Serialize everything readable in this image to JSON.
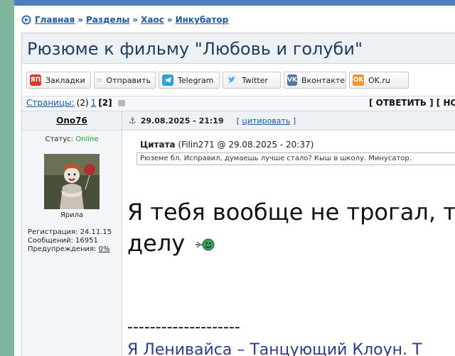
{
  "breadcrumbs": [
    {
      "label": "Главная"
    },
    {
      "label": "Разделы"
    },
    {
      "label": "Хаос"
    },
    {
      "label": "Инкубатор"
    }
  ],
  "breadcrumb_sep": "»",
  "topic": {
    "title": "Рюзюме к фильму \"Любовь и голуби\""
  },
  "share": [
    {
      "label": "Закладки",
      "icon": "yandex-icon",
      "icon_text": "ЯП",
      "color": "#d83b2a"
    },
    {
      "label": "Отправить",
      "icon": "mail-icon",
      "icon_text": "",
      "color": "#8a8a8a"
    },
    {
      "label": "Telegram",
      "icon": "telegram-icon",
      "icon_text": "",
      "color": "#2aa3de"
    },
    {
      "label": "Twitter",
      "icon": "twitter-icon",
      "icon_text": "",
      "color": "#4aa8e6"
    },
    {
      "label": "Вконтакте",
      "icon": "vk-icon",
      "icon_text": "VK",
      "color": "#4a76a8"
    },
    {
      "label": "OK.ru",
      "icon": "odnoklassniki-icon",
      "icon_text": "OK",
      "color": "#f2932c"
    }
  ],
  "pagination": {
    "label": "Страницы:",
    "total": "(2)",
    "pages": [
      "1",
      "[2]"
    ],
    "actions": "[ ОТВЕТИТЬ ] [ НОВАЯ"
  },
  "post": {
    "author": "Ono76",
    "status_label": "Статус:",
    "status_value": "Online",
    "avatar_caption": "Ярила",
    "reg": "Регистрация: 24.11.15",
    "messages": "Сообщений: 16951",
    "warn_label": "Предупреждения:",
    "warn_value": "0%",
    "date": "29.08.2025 - 21:19",
    "cite_open": "[",
    "cite_label": "цитировать",
    "cite_close": "]",
    "quote_label": "Цитата",
    "quote_meta": "(Filin271 @ 29.08.2025 - 20:37)",
    "quote_text": "Рюземе бл. Исправил, думаешь лучше стало? Кыш в школу. Минусатор.",
    "body_line1": "Я тебя вообще не трогал, ты",
    "body_line2": "делу",
    "divider": "--------------------",
    "signature": "Я Ленивайса – Танцующий Клоун. Т"
  }
}
